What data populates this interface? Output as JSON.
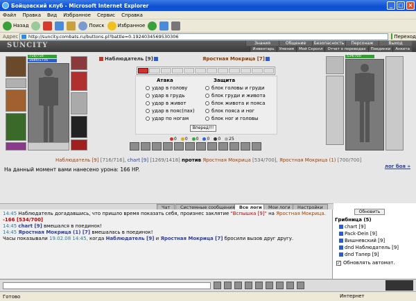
{
  "window": {
    "title": "Бойцовский клуб - Microsoft Internet Explorer"
  },
  "menu": [
    "Файл",
    "Правка",
    "Вид",
    "Избранное",
    "Сервис",
    "Справка"
  ],
  "toolbar": {
    "back": "Назад",
    "search": "Поиск",
    "favorites": "Избранное"
  },
  "address": {
    "label": "Адрес",
    "url": "http://suncity.combats.ru/buttons.pl?battle=0.1924034569530306",
    "go": "Переход"
  },
  "game": {
    "logo": "SUNCITY",
    "nav_top": [
      "Знания",
      "Общение",
      "Безопасность",
      "Персонаж",
      "Выход"
    ],
    "nav_sub": [
      "Инвентарь",
      "Умения",
      "Мой Скролл",
      "Отчет о переводах",
      "Поединки",
      "Анкета"
    ],
    "left": {
      "hp": "716/716",
      "mp": "1685/1735",
      "name": "Наблюдатель [9]"
    },
    "right": {
      "hp": "534/700",
      "name": "Яростная Мокрица [7]"
    },
    "attack": {
      "header": "Атака",
      "options": [
        "удар в голову",
        "удар в грудь",
        "удар в живот",
        "удар в пояс(пах)",
        "удар по ногам"
      ]
    },
    "defense": {
      "header": "Защита",
      "options": [
        "блок головы и груди",
        "блок груди и живота",
        "блок живота и пояса",
        "блок пояса и ног",
        "блок ног и головы"
      ]
    },
    "forward": "Вперед!!!",
    "counts": [
      "0",
      "0",
      "0",
      "0",
      "0",
      "25"
    ],
    "vs": {
      "p1": "Наблюдатель [9]",
      "p1hp": "[716/716],",
      "p2": "chart [9]",
      "p2hp": "[1269/1418]",
      "word": "против",
      "p3": "Яростная Мокрица",
      "p3hp": "[534/700],",
      "p4": "Яростная Мокрица (1)",
      "p4hp": "[700/700]"
    },
    "damage": "На данный момент вами нанесено урона: 166 HP.",
    "log_link": "лог боя »"
  },
  "tabs": [
    "Чат",
    "Системные сообщения",
    "Все логи",
    "Мои логи",
    "Настройки"
  ],
  "chat": [
    {
      "time": "14:45",
      "text": "Наблюдатель догадавшись, что пришло время показать себя, произнес заклятие",
      "spell": "\"Вспышка [9]\"",
      "to": "на",
      "target": "Яростная Мокрица.",
      "dmg": "-166 [534/700]"
    },
    {
      "time": "14:45",
      "who": "chart [9]",
      "text": "вмешался в поединок!"
    },
    {
      "time": "14:45",
      "who": "Яростная Мокрица (1) [7]",
      "text": "вмешалась в поединок!"
    },
    {
      "pre": "Часы показывали",
      "date": "19.02.08 14:45,",
      "when": "когда",
      "a": "Наблюдатель [9]",
      "and": "и",
      "b": "Яростная Мокрица [7]",
      "post": "бросили вызов друг другу."
    }
  ],
  "side": {
    "refresh": "Обновить",
    "group": "Грибница (5)",
    "users": [
      "chart [9]",
      "Pack-Dein [9]",
      "Вишневский [9]",
      "dnd Наблюдатель [9]",
      "dnd Тапер [9]"
    ],
    "auto": "Обновлять автомат."
  },
  "status": {
    "left": "Готово",
    "right": "Интернет"
  }
}
